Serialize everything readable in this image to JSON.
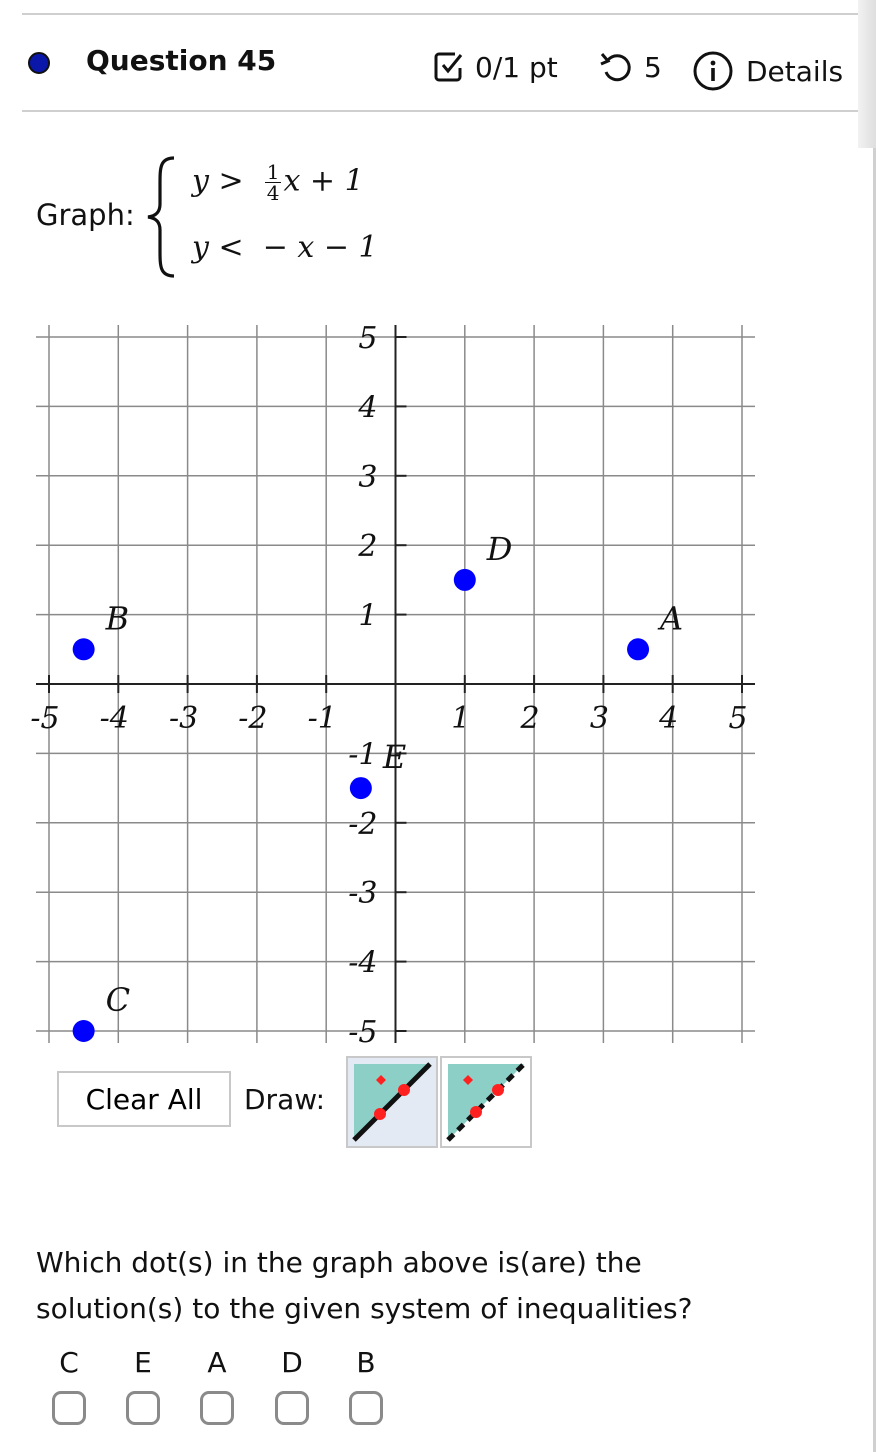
{
  "header": {
    "question_title": "Question 45",
    "score": "0/1 pt",
    "attempts": "5",
    "details_label": "Details",
    "status_dot_color": "#0a17a8",
    "icons": {
      "status": "status-dot-icon",
      "score": "checkbox-check-icon",
      "attempts": "retry-icon",
      "details": "info-circle-icon"
    }
  },
  "problem": {
    "prompt_label": "Graph:",
    "inequalities": [
      {
        "lhs": "y",
        "op": ">",
        "frac_num": "1",
        "frac_den": "4",
        "rest": "x + 1",
        "text": "y > (1/4)x + 1"
      },
      {
        "lhs": "y",
        "op": "<",
        "rest": "− x − 1",
        "text": "y < −x − 1"
      }
    ]
  },
  "graph": {
    "x_range": [
      -5,
      5
    ],
    "y_range": [
      -5,
      5
    ],
    "grid_step": 1,
    "x_tick_labels": [
      "-5",
      "-4",
      "-3",
      "-2",
      "-1",
      "1",
      "2",
      "3",
      "4",
      "5"
    ],
    "y_tick_labels": [
      "5",
      "4",
      "3",
      "2",
      "1",
      "-1",
      "-2",
      "-3",
      "-4",
      "-5"
    ],
    "dot_color": "#0000ff",
    "points": [
      {
        "label": "A",
        "x": 3.5,
        "y": 0.5
      },
      {
        "label": "B",
        "x": -4.5,
        "y": 0.5
      },
      {
        "label": "C",
        "x": -4.5,
        "y": -5
      },
      {
        "label": "D",
        "x": 1,
        "y": 1.5
      },
      {
        "label": "E",
        "x": -0.5,
        "y": -1.5
      }
    ]
  },
  "toolbar": {
    "clear_label": "Clear All",
    "draw_label": "Draw:",
    "tools": [
      {
        "name": "solid-line-inequality-tool",
        "selected": true
      },
      {
        "name": "dashed-line-inequality-tool",
        "selected": false
      }
    ],
    "fill_color": "#8ccfc6",
    "point_color": "#ff2020"
  },
  "question": {
    "text": "Which dot(s) in the graph above is(are) the solution(s) to the given system of inequalities?",
    "options": [
      {
        "label": "C",
        "checked": false
      },
      {
        "label": "E",
        "checked": false
      },
      {
        "label": "A",
        "checked": false
      },
      {
        "label": "D",
        "checked": false
      },
      {
        "label": "B",
        "checked": false
      }
    ]
  }
}
